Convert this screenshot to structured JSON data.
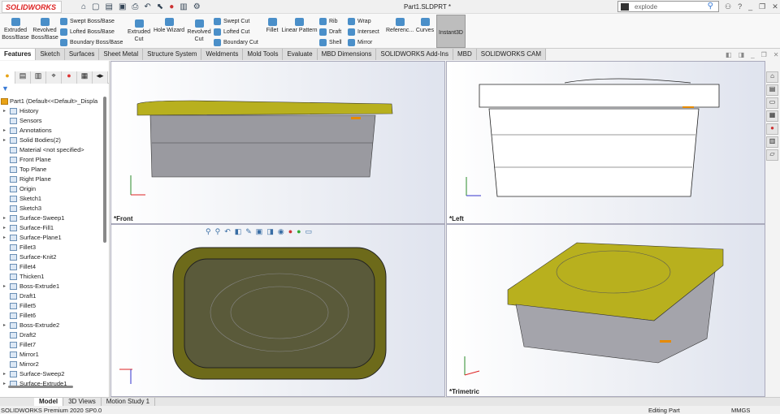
{
  "app": {
    "logo": "SOLIDWORKS",
    "doc_title": "Part1.SLDPRT *",
    "search_placeholder": "explode",
    "quick_access": [
      "home",
      "new",
      "open",
      "save",
      "print",
      "undo",
      "select",
      "traffic-light",
      "file-props",
      "options"
    ],
    "window_controls": [
      "user",
      "?",
      "_",
      "❐",
      "✕"
    ]
  },
  "ribbon": {
    "big": [
      {
        "label": "Extruded Boss/Base"
      },
      {
        "label": "Revolved Boss/Base"
      },
      {
        "label": "Extruded Cut"
      },
      {
        "label": "Hole Wizard"
      },
      {
        "label": "Revolved Cut"
      },
      {
        "label": "Fillet"
      },
      {
        "label": "Linear Pattern"
      },
      {
        "label": "Referenc..."
      },
      {
        "label": "Curves"
      }
    ],
    "small": [
      "Swept Boss/Base",
      "Lofted Boss/Base",
      "Boundary Boss/Base",
      "Swept Cut",
      "Lofted Cut",
      "Boundary Cut",
      "Rib",
      "Draft",
      "Shell",
      "Wrap",
      "Intersect",
      "Mirror"
    ],
    "instant3d": "Instant3D"
  },
  "tabs": [
    "Features",
    "Sketch",
    "Surfaces",
    "Sheet Metal",
    "Structure System",
    "Weldments",
    "Mold Tools",
    "Evaluate",
    "MBD Dimensions",
    "SOLIDWORKS Add-Ins",
    "MBD",
    "SOLIDWORKS CAM"
  ],
  "tree": {
    "root": "Part1  (Default<<Default>_Displa",
    "items": [
      {
        "label": "History",
        "exp": true
      },
      {
        "label": "Sensors",
        "exp": false
      },
      {
        "label": "Annotations",
        "exp": true
      },
      {
        "label": "Solid Bodies(2)",
        "exp": true
      },
      {
        "label": "Material <not specified>",
        "exp": false
      },
      {
        "label": "Front Plane",
        "exp": false
      },
      {
        "label": "Top Plane",
        "exp": false
      },
      {
        "label": "Right Plane",
        "exp": false
      },
      {
        "label": "Origin",
        "exp": false
      },
      {
        "label": "Sketch1",
        "exp": false
      },
      {
        "label": "Sketch3",
        "exp": false
      },
      {
        "label": "Surface-Sweep1",
        "exp": true
      },
      {
        "label": "Surface-Fill1",
        "exp": true
      },
      {
        "label": "Surface-Plane1",
        "exp": true
      },
      {
        "label": "Fillet3",
        "exp": false
      },
      {
        "label": "Surface-Knit2",
        "exp": false
      },
      {
        "label": "Fillet4",
        "exp": false
      },
      {
        "label": "Thicken1",
        "exp": false
      },
      {
        "label": "Boss-Extrude1",
        "exp": true
      },
      {
        "label": "Draft1",
        "exp": false
      },
      {
        "label": "Fillet5",
        "exp": false
      },
      {
        "label": "Fillet6",
        "exp": false
      },
      {
        "label": "Boss-Extrude2",
        "exp": true
      },
      {
        "label": "Draft2",
        "exp": false
      },
      {
        "label": "Fillet7",
        "exp": false
      },
      {
        "label": "Mirror1",
        "exp": false
      },
      {
        "label": "Mirror2",
        "exp": false
      },
      {
        "label": "Surface-Sweep2",
        "exp": true
      },
      {
        "label": "Surface-Extrude1",
        "exp": true
      }
    ]
  },
  "viewports": [
    "*Front",
    "*Left",
    "*Trimetric"
  ],
  "bottom_tabs": [
    "Model",
    "3D Views",
    "Motion Study 1"
  ],
  "status": {
    "left": "SOLIDWORKS Premium 2020 SP0.0",
    "mode": "Editing Part",
    "units": "MMGS"
  },
  "colors": {
    "lid": "#b8b01e",
    "tab_active": "#ffffff"
  }
}
